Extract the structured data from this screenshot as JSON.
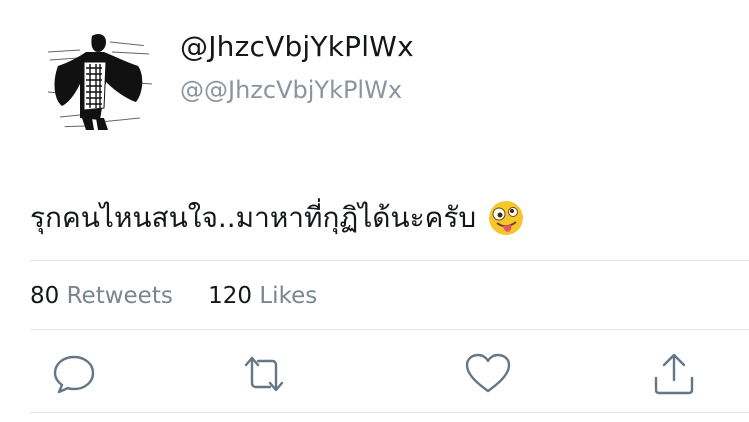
{
  "user": {
    "display_name": "@JhzcVbjYkPlWx",
    "handle": "@@JhzcVbjYkPlWx"
  },
  "tweet": {
    "text": "รุกคนไหนสนใจ..มาหาที่กุฏิได้นะครับ",
    "emoji_icon": "zany-face-icon"
  },
  "stats": {
    "retweets_count": "80",
    "retweets_label": "Retweets",
    "likes_count": "120",
    "likes_label": "Likes"
  },
  "actions": [
    {
      "name": "reply",
      "icon": "speech-bubble-icon"
    },
    {
      "name": "retweet",
      "icon": "retweet-arrows-icon"
    },
    {
      "name": "like",
      "icon": "heart-icon"
    },
    {
      "name": "share",
      "icon": "share-upload-icon"
    }
  ],
  "colors": {
    "text": "#14171a",
    "secondary": "#8a959e",
    "icon": "#657786",
    "divider": "#e1e8ed"
  }
}
